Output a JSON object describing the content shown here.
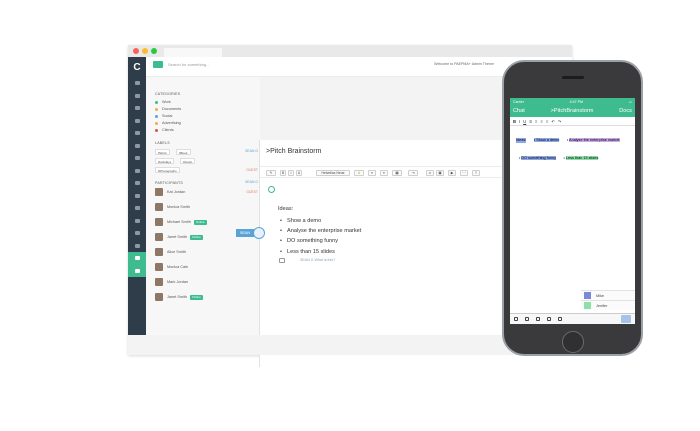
{
  "app": {
    "logo": "C",
    "search_placeholder": "Search for something...",
    "welcome": "Welcome to PAEPMA+ Admin Theme"
  },
  "sidebar": {
    "categories_heading": "CATEGORIES",
    "categories": [
      {
        "label": "Work",
        "color": "#3fbc8f"
      },
      {
        "label": "Documents",
        "color": "#f0ad4e"
      },
      {
        "label": "Social",
        "color": "#5aa3d8"
      },
      {
        "label": "Advertising",
        "color": "#f0ad4e"
      },
      {
        "label": "Clients",
        "color": "#d9534f"
      }
    ],
    "labels_heading": "LABELS",
    "labels": [
      "#Work",
      "#Book",
      "#Holidays",
      "#Audio",
      "#Photographs"
    ],
    "user_labels": [
      {
        "label": "SEAN G",
        "color": "#5aa3d8"
      },
      {
        "label": "GUEST",
        "color": "#e07e6d"
      }
    ],
    "participants_heading": "PARTICIPANTS",
    "participant_roles": [
      {
        "label": "SEAN G",
        "color": "#5aa3d8"
      },
      {
        "label": "GUEST",
        "color": "#e07e6d"
      }
    ],
    "participants": [
      {
        "name": "Kat Jordan",
        "online": ""
      },
      {
        "name": "Monica Smith",
        "online": ""
      },
      {
        "name": "Michael Smith",
        "online": "Online"
      },
      {
        "name": "Janet Smith",
        "online": "Online"
      },
      {
        "name": "Alice Smith",
        "online": ""
      },
      {
        "name": "Monica Cale",
        "online": ""
      },
      {
        "name": "Mark Jordan",
        "online": ""
      },
      {
        "name": "Janet Smith",
        "online": "Online"
      }
    ]
  },
  "cursor_tag": "SEAN",
  "editor": {
    "title": ">Pitch Brainstorm",
    "toolbar": [
      "B",
      "I",
      "U",
      "Helvetica Neue",
      "A",
      "≡",
      "⋯"
    ],
    "ideas_label": "Ideas:",
    "bullets": [
      "Show a demo",
      "Analyse the enterprise market",
      "DO something funny",
      "Less than 15 slides"
    ],
    "comment": "SEAN G  What is this?"
  },
  "phone": {
    "carrier": "Carrier",
    "time": "4:47 PM",
    "chat": "Chat",
    "title": ">PitchBrainstorm",
    "docs": "Docs",
    "toolbar": [
      "B",
      "I",
      "U",
      "S",
      "≡",
      "≡",
      "≡",
      "↶",
      "↷"
    ],
    "ideas": "Ideas:",
    "lines": [
      {
        "text": "Show a demo",
        "color": "#8ea8e8"
      },
      {
        "text": "Analyse the enterprise market",
        "color": "#c9a7e8"
      },
      {
        "text": "DO something funny",
        "color": "#8ea8e8"
      },
      {
        "text": "Less than 15 slides",
        "color": "#8ce0a9"
      }
    ],
    "users": [
      {
        "name": "Mike",
        "color": "#7b88d8"
      },
      {
        "name": "Jenifer",
        "color": "#8ce0a9"
      }
    ]
  }
}
